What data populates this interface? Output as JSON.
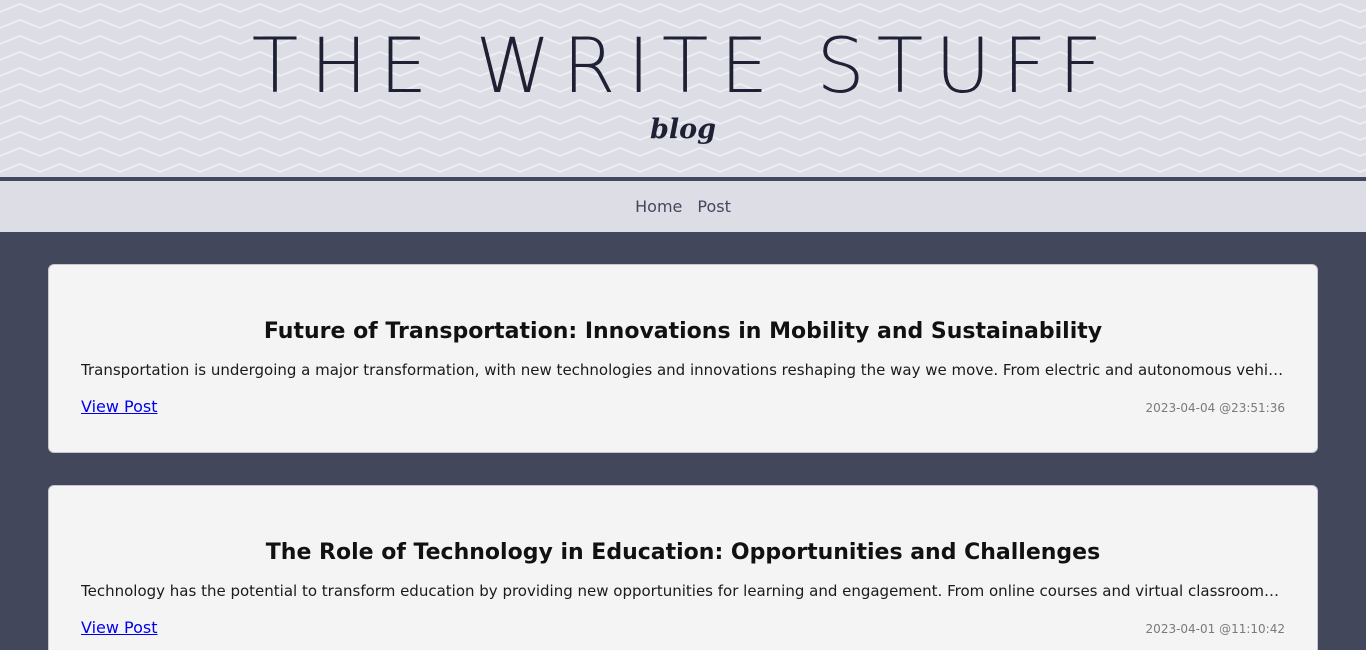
{
  "header": {
    "title": "THE WRITE STUFF",
    "subtitle": "blog"
  },
  "nav": {
    "items": [
      {
        "label": "Home"
      },
      {
        "label": "Post"
      }
    ]
  },
  "posts": [
    {
      "title": "Future of Transportation: Innovations in Mobility and Sustainability",
      "excerpt": "Transportation is undergoing a major transformation, with new technologies and innovations reshaping the way we move. From electric and autonomous vehicles to…",
      "link_label": "View Post",
      "timestamp": "2023-04-04 @23:51:36"
    },
    {
      "title": "The Role of Technology in Education: Opportunities and Challenges",
      "excerpt": "Technology has the potential to transform education by providing new opportunities for learning and engagement. From online courses and virtual classrooms to pe…",
      "link_label": "View Post",
      "timestamp": "2023-04-01 @11:10:42"
    }
  ],
  "colors": {
    "header_bg": "#dcdde5",
    "page_bg": "#42475c",
    "card_bg": "#f4f4f4",
    "link": "#0000ee"
  }
}
